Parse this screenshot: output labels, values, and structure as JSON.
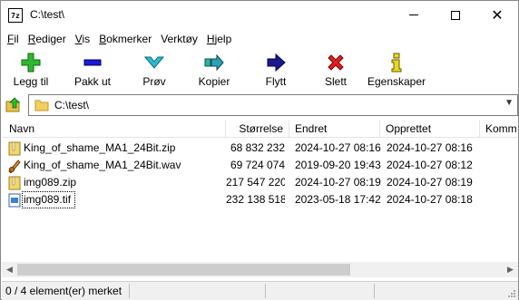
{
  "window": {
    "title": "C:\\test\\",
    "app_icon_text": "7z"
  },
  "menu": [
    {
      "label": "Fil",
      "accel": "F",
      "rest": "il"
    },
    {
      "label": "Rediger",
      "accel": "R",
      "rest": "ediger"
    },
    {
      "label": "Vis",
      "accel": "V",
      "rest": "is"
    },
    {
      "label": "Bokmerker",
      "accel": "B",
      "rest": "okmerker"
    },
    {
      "label": "Verktøy",
      "accel": "",
      "rest": "Verktøy"
    },
    {
      "label": "Hjelp",
      "accel": "H",
      "rest": "jelp"
    }
  ],
  "toolbar": {
    "add": "Legg til",
    "extract": "Pakk ut",
    "test": "Prøv",
    "copy": "Kopier",
    "move": "Flytt",
    "delete": "Slett",
    "properties": "Egenskaper"
  },
  "address": {
    "path": "C:\\test\\"
  },
  "columns": {
    "name": "Navn",
    "size": "Størrelse",
    "modified": "Endret",
    "created": "Opprettet",
    "comment": "Komm"
  },
  "files": [
    {
      "name": "King_of_shame_MA1_24Bit.zip",
      "size": "68 832 232",
      "modified": "2024-10-27 08:16",
      "created": "2024-10-27 08:16",
      "icon": "zip-file-icon"
    },
    {
      "name": "King_of_shame_MA1_24Bit.wav",
      "size": "69 724 074",
      "modified": "2019-09-20 19:43",
      "created": "2024-10-27 08:12",
      "icon": "audio-file-icon"
    },
    {
      "name": "img089.zip",
      "size": "217 547 220",
      "modified": "2024-10-27 08:19",
      "created": "2024-10-27 08:19",
      "icon": "zip-file-icon"
    },
    {
      "name": "img089.tif",
      "size": "232 138 518",
      "modified": "2023-05-18 17:42",
      "created": "2024-10-27 08:18",
      "icon": "image-file-icon"
    }
  ],
  "status": {
    "text": "0 / 4 element(er) merket"
  },
  "colors": {
    "add_green": "#2fb82f",
    "extract_blue": "#1a1ad6",
    "test_cyan": "#2bbbd0",
    "move_navy": "#1a1a8c",
    "delete_red": "#e02020",
    "props_yellow": "#e8d81a"
  }
}
